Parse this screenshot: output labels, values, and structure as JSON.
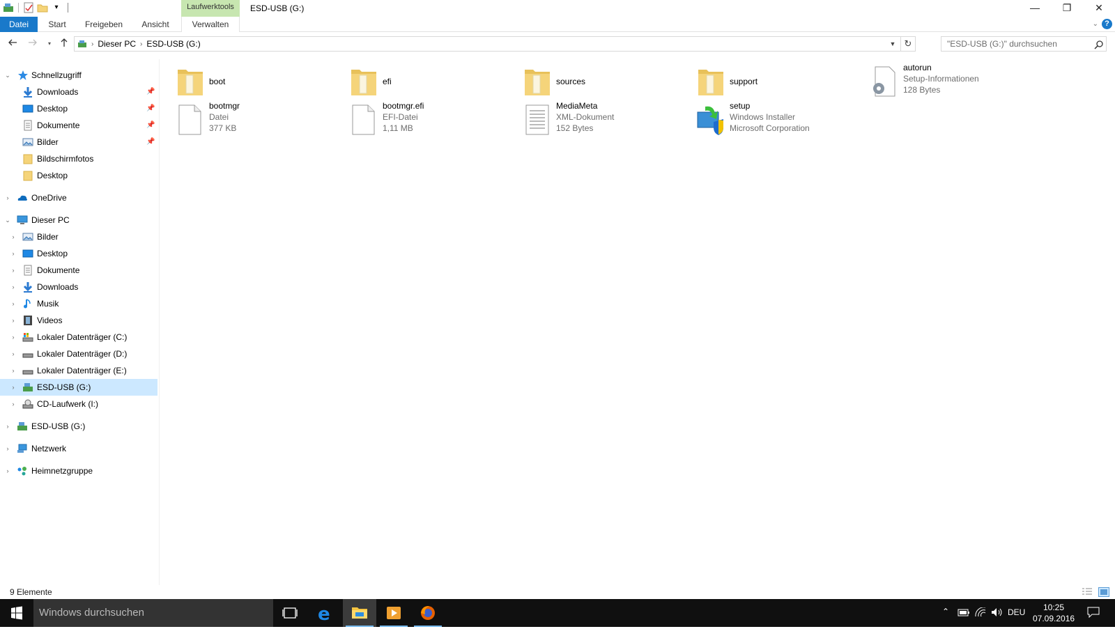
{
  "window": {
    "title": "ESD-USB (G:)",
    "context_tab_group": "Laufwerktools",
    "controls": {
      "minimize": "—",
      "restore": "❐",
      "close": "✕"
    }
  },
  "ribbon": {
    "tabs": [
      "Datei",
      "Start",
      "Freigeben",
      "Ansicht",
      "Verwalten"
    ],
    "help": "?"
  },
  "navigation": {
    "breadcrumb": [
      "Dieser PC",
      "ESD-USB (G:)"
    ],
    "search_placeholder": "\"ESD-USB (G:)\" durchsuchen"
  },
  "sidebar": {
    "quick_access": {
      "label": "Schnellzugriff",
      "items": [
        {
          "label": "Downloads",
          "icon": "downloads-icon",
          "pinned": true
        },
        {
          "label": "Desktop",
          "icon": "desktop-icon",
          "pinned": true
        },
        {
          "label": "Dokumente",
          "icon": "documents-icon",
          "pinned": true
        },
        {
          "label": "Bilder",
          "icon": "pictures-icon",
          "pinned": true
        },
        {
          "label": "Bildschirmfotos",
          "icon": "folder-icon",
          "pinned": false
        },
        {
          "label": "Desktop",
          "icon": "folder-icon",
          "pinned": false
        }
      ]
    },
    "onedrive": "OneDrive",
    "this_pc": {
      "label": "Dieser PC",
      "items": [
        {
          "label": "Bilder",
          "icon": "pictures-icon"
        },
        {
          "label": "Desktop",
          "icon": "desktop-icon"
        },
        {
          "label": "Dokumente",
          "icon": "documents-icon"
        },
        {
          "label": "Downloads",
          "icon": "downloads-icon"
        },
        {
          "label": "Musik",
          "icon": "music-icon"
        },
        {
          "label": "Videos",
          "icon": "videos-icon"
        },
        {
          "label": "Lokaler Datenträger (C:)",
          "icon": "system-drive-icon"
        },
        {
          "label": "Lokaler Datenträger (D:)",
          "icon": "drive-icon"
        },
        {
          "label": "Lokaler Datenträger (E:)",
          "icon": "drive-icon"
        },
        {
          "label": "ESD-USB (G:)",
          "icon": "usb-drive-icon",
          "selected": true
        },
        {
          "label": "CD-Laufwerk (I:)",
          "icon": "cd-drive-icon"
        }
      ]
    },
    "usb_root": "ESD-USB (G:)",
    "network": "Netzwerk",
    "homegroup": "Heimnetzgruppe"
  },
  "files": [
    {
      "name": "boot",
      "type": "folder",
      "lines": []
    },
    {
      "name": "efi",
      "type": "folder",
      "lines": []
    },
    {
      "name": "sources",
      "type": "folder",
      "lines": []
    },
    {
      "name": "support",
      "type": "folder",
      "lines": []
    },
    {
      "name": "autorun",
      "type": "settings",
      "lines": [
        "Setup-Informationen",
        "128 Bytes"
      ]
    },
    {
      "name": "bootmgr",
      "type": "file",
      "lines": [
        "Datei",
        "377 KB"
      ]
    },
    {
      "name": "bootmgr.efi",
      "type": "file",
      "lines": [
        "EFI-Datei",
        "1,11 MB"
      ]
    },
    {
      "name": "MediaMeta",
      "type": "text",
      "lines": [
        "XML-Dokument",
        "152 Bytes"
      ]
    },
    {
      "name": "setup",
      "type": "installer",
      "lines": [
        "Windows Installer",
        "Microsoft Corporation"
      ]
    }
  ],
  "status": {
    "item_count": "9 Elemente"
  },
  "taskbar": {
    "search_placeholder": "Windows durchsuchen",
    "language": "DEU",
    "time": "10:25",
    "date": "07.09.2016"
  },
  "colors": {
    "accent": "#1979ca",
    "context_tab": "#c7e6b0",
    "selection": "#cce8ff",
    "taskbar": "#101010",
    "folder": "#f5d47a"
  }
}
